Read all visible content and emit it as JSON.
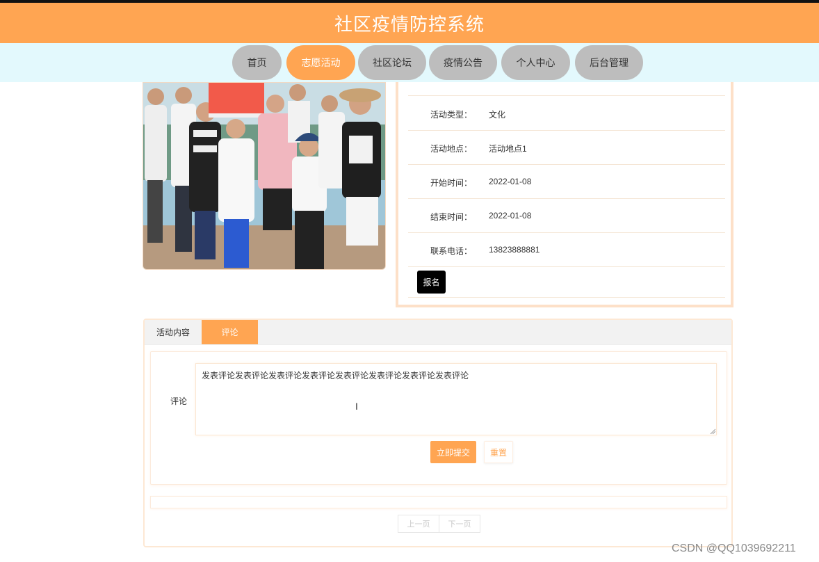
{
  "header": {
    "title": "社区疫情防控系统",
    "accent_color": "#ffa552"
  },
  "nav": {
    "items": [
      {
        "label": "首页"
      },
      {
        "label": "志愿活动",
        "active": true
      },
      {
        "label": "社区论坛"
      },
      {
        "label": "疫情公告"
      },
      {
        "label": "个人中心"
      },
      {
        "label": "后台管理"
      }
    ]
  },
  "activity": {
    "photo_alt": "group-photo",
    "fields": [
      {
        "label": "活动类型：",
        "value": "文化"
      },
      {
        "label": "活动地点：",
        "value": "活动地点1"
      },
      {
        "label": "开始时间：",
        "value": "2022-01-08"
      },
      {
        "label": "结束时间：",
        "value": "2022-01-08"
      },
      {
        "label": "联系电话：",
        "value": "13823888881"
      }
    ],
    "signup_label": "报名"
  },
  "tabs": {
    "items": [
      {
        "label": "活动内容"
      },
      {
        "label": "评论",
        "active": true
      }
    ]
  },
  "comment_form": {
    "label": "评论",
    "value": "发表评论发表评论发表评论发表评论发表评论发表评论发表评论发表评论",
    "submit_label": "立即提交",
    "reset_label": "重置"
  },
  "pagination": {
    "prev_label": "上一页",
    "next_label": "下一页"
  },
  "watermark": "CSDN @QQ1039692211"
}
